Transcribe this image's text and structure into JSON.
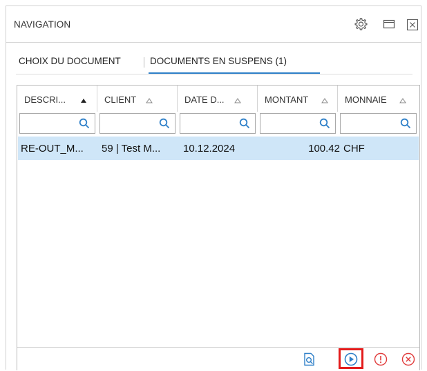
{
  "header": {
    "title": "NAVIGATION",
    "icons": [
      "gear-icon",
      "window-icon",
      "close-icon"
    ]
  },
  "tabs": [
    {
      "label": "CHOIX DU DOCUMENT",
      "active": false
    },
    {
      "label": "DOCUMENTS EN SUSPENS (1)",
      "active": true
    }
  ],
  "grid": {
    "columns": [
      {
        "label": "DESCRI...",
        "sort": "descending"
      },
      {
        "label": "CLIENT",
        "sort": "none"
      },
      {
        "label": "DATE D...",
        "sort": "none"
      },
      {
        "label": "MONTANT",
        "sort": "none"
      },
      {
        "label": "MONNAIE",
        "sort": "none"
      }
    ],
    "filters": [
      "",
      "",
      "",
      "",
      ""
    ],
    "rows": [
      {
        "description": "RE-OUT_M...",
        "client": "59 | Test M...",
        "date": "10.12.2024",
        "montant": "100.42",
        "monnaie": "CHF"
      }
    ]
  },
  "footer": {
    "buttons": [
      "preview-icon",
      "play-icon",
      "warning-icon",
      "cancel-icon"
    ]
  },
  "colors": {
    "accent": "#2d7fc8",
    "selected_row": "#cfe6f8",
    "highlight_border": "#e31b1b",
    "warning": "#e03a3a"
  }
}
